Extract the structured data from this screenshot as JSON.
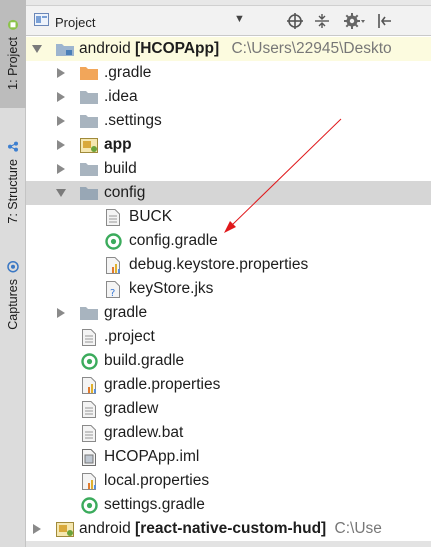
{
  "side_tabs": [
    {
      "label": "1: Project",
      "icon": "android-icon"
    },
    {
      "label": "7: Structure",
      "icon": "structure-icon"
    },
    {
      "label": "Captures",
      "icon": "captures-icon"
    }
  ],
  "toolbar": {
    "view_label": "Project",
    "dropdown_icon": "dropdown-arrow",
    "icons": [
      "target-icon",
      "collapse-icon",
      "gear-icon",
      "hide-panel-icon"
    ]
  },
  "tree": {
    "root": {
      "name": "android",
      "module": "[HCOPApp]",
      "path": "C:\\Users\\22945\\Deskto"
    },
    "rows": [
      {
        "label": ".gradle"
      },
      {
        "label": ".idea"
      },
      {
        "label": ".settings"
      },
      {
        "label": "app"
      },
      {
        "label": "build"
      },
      {
        "label": "config"
      },
      {
        "label": "BUCK"
      },
      {
        "label": "config.gradle"
      },
      {
        "label": "debug.keystore.properties"
      },
      {
        "label": "keyStore.jks"
      },
      {
        "label": "gradle"
      },
      {
        "label": ".project"
      },
      {
        "label": "build.gradle"
      },
      {
        "label": "gradle.properties"
      },
      {
        "label": "gradlew"
      },
      {
        "label": "gradlew.bat"
      },
      {
        "label": "HCOPApp.iml"
      },
      {
        "label": "local.properties"
      },
      {
        "label": "settings.gradle"
      }
    ],
    "second_root": {
      "name": "android",
      "module": "[react-native-custom-hud]",
      "path": "C:\\Use"
    }
  },
  "colors": {
    "accent_arrow": "#e0181b",
    "selected_row": "#d6d6d6",
    "root_row": "#fcfbdf"
  }
}
